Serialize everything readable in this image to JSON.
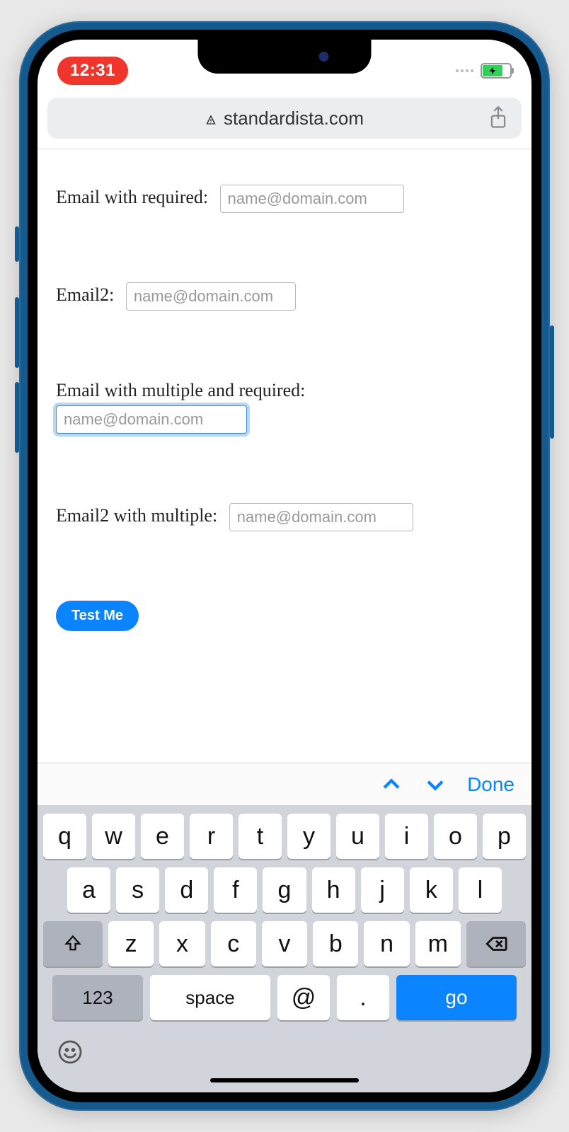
{
  "status": {
    "time": "12:31"
  },
  "urlbar": {
    "domain": "standardista.com"
  },
  "form": {
    "f1": {
      "label": "Email with required: ",
      "placeholder": "name@domain.com",
      "value": ""
    },
    "f2": {
      "label": "Email2: ",
      "placeholder": "name@domain.com",
      "value": ""
    },
    "f3": {
      "label": "Email with multiple and required:",
      "placeholder": "name@domain.com",
      "value": ""
    },
    "f4": {
      "label": "Email2 with multiple: ",
      "placeholder": "name@domain.com",
      "value": ""
    },
    "submit": "Test Me"
  },
  "kb_accessory": {
    "done": "Done"
  },
  "keyboard": {
    "row1": [
      "q",
      "w",
      "e",
      "r",
      "t",
      "y",
      "u",
      "i",
      "o",
      "p"
    ],
    "row2": [
      "a",
      "s",
      "d",
      "f",
      "g",
      "h",
      "j",
      "k",
      "l"
    ],
    "row3": [
      "z",
      "x",
      "c",
      "v",
      "b",
      "n",
      "m"
    ],
    "numkey": "123",
    "space": "space",
    "at": "@",
    "dot": ".",
    "go": "go"
  }
}
